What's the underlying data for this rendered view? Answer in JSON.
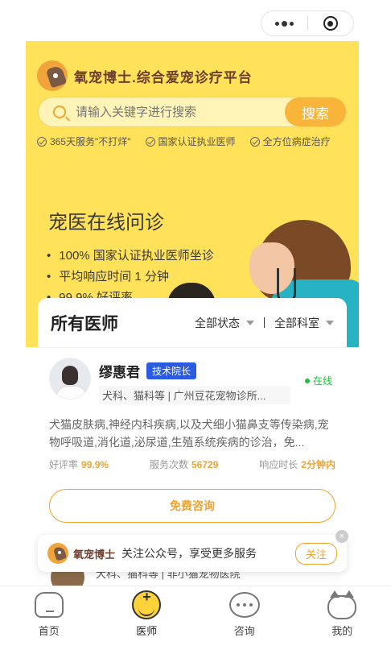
{
  "capsule": {
    "more_icon": "more-dots-icon",
    "minimize_icon": "minus-icon",
    "close_icon": "target-icon"
  },
  "banner": {
    "brand": "氧宠博士.综合爱宠诊疗平台",
    "search": {
      "placeholder": "请输入关键字进行搜索",
      "button": "搜索"
    },
    "features": [
      "365天服务\"不打烊\"",
      "国家认证执业医师",
      "全方位病症治疗"
    ],
    "promo_title": "宠医在线问诊",
    "promo_points": [
      "100% 国家认证执业医师坐诊",
      "平均响应时间 1 分钟",
      "99.9% 好评率"
    ]
  },
  "doctors": {
    "title": "所有医师",
    "filters": [
      "全部状态",
      "全部科室"
    ],
    "items": [
      {
        "name": "缪惠君",
        "tag": "技术院长",
        "dept": "犬科、猫科等 | 广州豆花宠物诊所...",
        "status": "在线",
        "desc": "犬猫皮肤病,神经内科疾病,以及犬细小猫鼻支等传染病,宠物呼吸道,消化道,泌尿道,生殖系统疾病的诊治，免...",
        "stats": [
          {
            "label": "好评率",
            "value": "99.9%"
          },
          {
            "label": "服务次数",
            "value": "56729"
          },
          {
            "label": "响应时长",
            "value": "2分钟内"
          }
        ],
        "consult": "免费咨询"
      }
    ],
    "next_dept": "犬科、猫科等 | 非小猫宠物医院"
  },
  "follow": {
    "brand": "氧宠博士",
    "text": "关注公众号，享受更多服务",
    "button": "关注",
    "close": "×"
  },
  "tabs": [
    {
      "label": "首页",
      "icon": "home-icon"
    },
    {
      "label": "医师",
      "icon": "doctor-icon"
    },
    {
      "label": "咨询",
      "icon": "chat-icon"
    },
    {
      "label": "我的",
      "icon": "cat-profile-icon"
    }
  ]
}
